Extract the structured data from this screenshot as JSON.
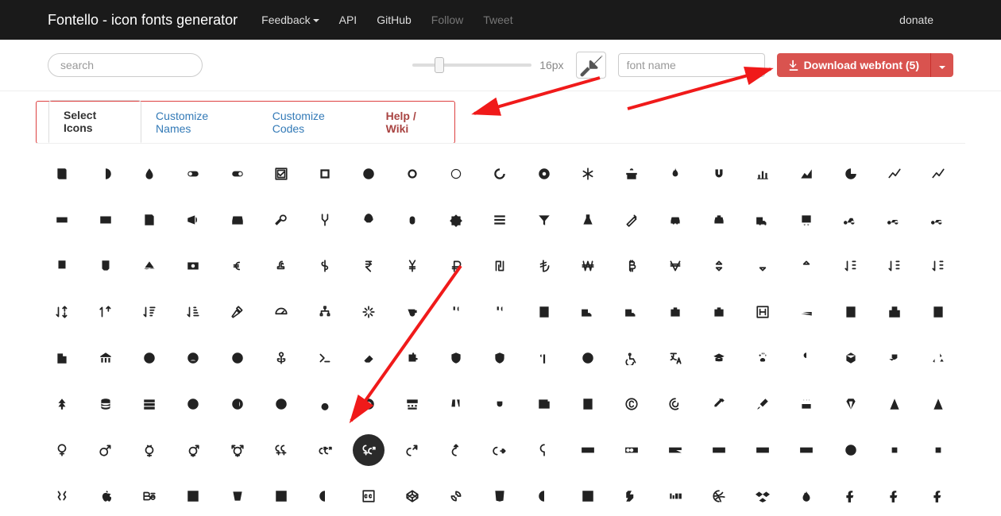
{
  "navbar": {
    "brand": "Fontello - icon fonts generator",
    "feedback": "Feedback",
    "api": "API",
    "github": "GitHub",
    "follow": "Follow",
    "tweet": "Tweet",
    "donate": "donate"
  },
  "toolbar": {
    "search_placeholder": "search",
    "slider_value": "16px",
    "fontname_placeholder": "font name",
    "download_label": "Download webfont (5)",
    "selected_count": 5
  },
  "tabs": {
    "select_icons": "Select Icons",
    "customize_names": "Customize Names",
    "customize_codes": "Customize Codes",
    "help_wiki": "Help / Wiki"
  },
  "colors": {
    "download_btn": "#d9534f",
    "tab_outline": "#dd4040",
    "arrow": "#f01a1a"
  },
  "icons": {
    "selected_index": 133,
    "grid_count": 168,
    "row_count": 8,
    "columns": 21
  }
}
